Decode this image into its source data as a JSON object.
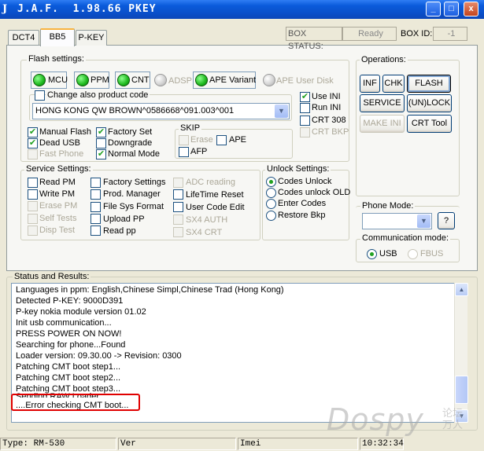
{
  "window": {
    "title": "J.A.F.  1.98.66 PKEY",
    "app_icon": "J",
    "controls": {
      "minimize": "_",
      "maximize": "□",
      "close": "x"
    }
  },
  "tabs": [
    "DCT4",
    "BB5",
    "P-KEY"
  ],
  "header": {
    "box_status_label": "BOX STATUS:",
    "box_status_value": "Ready",
    "box_id_label": "BOX ID:",
    "box_id_value": "-1"
  },
  "flash": {
    "title": "Flash settings:",
    "leds": [
      {
        "label": "MCU",
        "on": true
      },
      {
        "label": "PPM",
        "on": true
      },
      {
        "label": "CNT",
        "on": true
      },
      {
        "label": "ADSP",
        "on": false
      },
      {
        "label": "APE Variant",
        "on": true
      },
      {
        "label": "APE User Disk",
        "on": false
      }
    ],
    "product_code_label": "Change also product code",
    "product_code_value": "HONG KONG QW BROWN^0586668^091.003^001",
    "ini": [
      "Use INI",
      "Run INI",
      "CRT 308",
      "CRT BKP"
    ],
    "options": [
      "Manual Flash",
      "Factory Set",
      "Dead USB",
      "Downgrade",
      "Fast Phone",
      "Normal Mode"
    ],
    "skip_title": "SKIP",
    "skip": [
      "Erase",
      "APE",
      "AFP"
    ]
  },
  "service": {
    "title": "Service Settings:",
    "col1": [
      "Read PM",
      "Write PM",
      "Erase PM",
      "Self Tests",
      "Disp Test"
    ],
    "col2": [
      "Factory Settings",
      "Prod. Manager",
      "File Sys Format",
      "Upload PP",
      "Read pp"
    ],
    "col3": [
      "ADC reading",
      "LifeTime Reset",
      "User Code Edit",
      "SX4 AUTH",
      "SX4 CRT"
    ]
  },
  "unlock": {
    "title": "Unlock Settings:",
    "options": [
      "Codes Unlock",
      "Codes unlock OLD",
      "Enter Codes",
      "Restore Bkp"
    ]
  },
  "operations": {
    "title": "Operations:",
    "buttons": [
      "INF",
      "CHK",
      "FLASH",
      "SERVICE",
      "(UN)LOCK",
      "MAKE INI",
      "CRT Tool"
    ]
  },
  "phone_mode": {
    "title": "Phone Mode:",
    "value": "",
    "help": "?"
  },
  "comm_mode": {
    "title": "Communication mode:",
    "usb": "USB",
    "fbus": "FBUS"
  },
  "status_results": {
    "title": "Status and Results:",
    "lines": [
      "Languages in ppm: English,Chinese Simpl,Chinese Trad (Hong Kong)",
      "Detected P-KEY: 9000D391",
      "P-key nokia module version 01.02",
      "Init usb communication...",
      "PRESS POWER ON NOW!",
      "Searching for phone...Found",
      "Loader version: 09.30.00 -> Revision: 0300",
      "Patching CMT boot step1...",
      "Patching CMT boot step2...",
      "Patching CMT boot step3...",
      "Sending RAW Loader...",
      "....Error checking CMT boot..."
    ]
  },
  "statusbar": {
    "type": "Type: RM-530",
    "ver": "Ver",
    "imei": "Imei",
    "time": "10:32:34"
  },
  "watermark": {
    "text": "Dospy",
    "cn": "论坛 万人"
  }
}
